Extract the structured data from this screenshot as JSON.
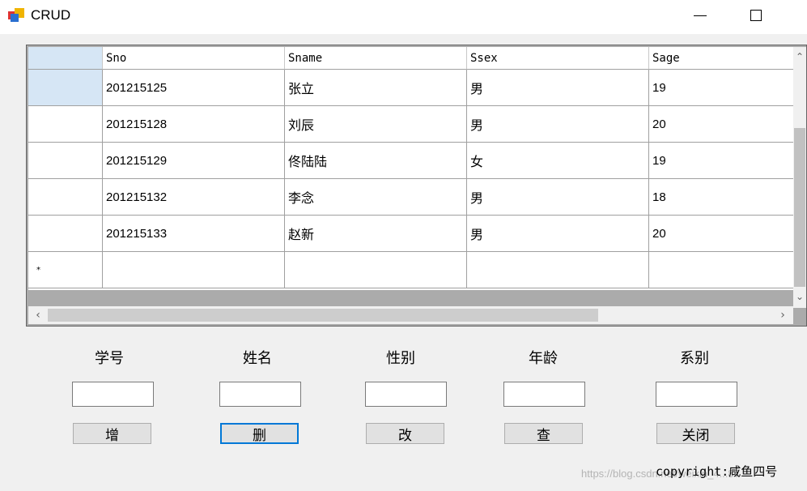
{
  "window": {
    "title": "CRUD"
  },
  "grid": {
    "columns": [
      "Sno",
      "Sname",
      "Ssex",
      "Sage"
    ],
    "rows": [
      [
        "201215125",
        "张立",
        "男",
        "19"
      ],
      [
        "201215128",
        "刘辰",
        "男",
        "20"
      ],
      [
        "201215129",
        "佟陆陆",
        "女",
        "19"
      ],
      [
        "201215132",
        "李念",
        "男",
        "18"
      ],
      [
        "201215133",
        "赵新",
        "男",
        "20"
      ]
    ],
    "new_row_marker": "*"
  },
  "form": {
    "labels": [
      "学号",
      "姓名",
      "性别",
      "年龄",
      "系别"
    ],
    "inputs": [
      "",
      "",
      "",
      "",
      ""
    ],
    "buttons": [
      "增",
      "删",
      "改",
      "查",
      "关闭"
    ]
  },
  "copyright": "copyright:咸鱼四号",
  "watermark": "https://blog.csdn.net/weixin_4...87",
  "colors": {
    "selection": "#d6e6f5",
    "focus_border": "#0078d7",
    "grid_background": "#ababab"
  }
}
